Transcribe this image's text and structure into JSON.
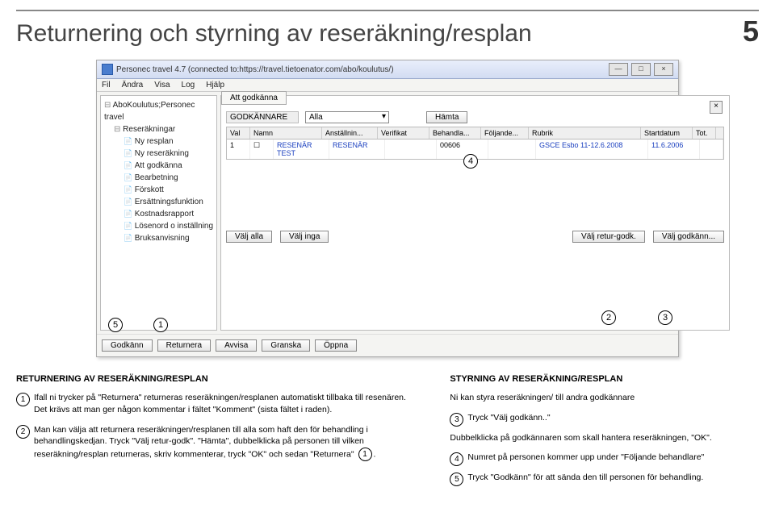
{
  "page": {
    "title": "Returnering och styrning av reseräkning/resplan",
    "number": "5"
  },
  "app": {
    "title": "Personec travel 4.7   (connected to:https://travel.tietoenator.com/abo/koulutus/)",
    "menu": [
      "Fil",
      "Ändra",
      "Visa",
      "Log",
      "Hjälp"
    ],
    "tree": {
      "root": "AboKoulutus;Personec travel",
      "group": "Reseräkningar",
      "items": [
        "Ny resplan",
        "Ny reseräkning",
        "Att godkänna",
        "Bearbetning",
        "Förskott",
        "Ersättningsfunktion",
        "Kostnadsrapport",
        "Lösenord o inställning",
        "Bruksanvisning"
      ]
    },
    "panel": {
      "tab": "Att godkänna",
      "filter_label": "GODKÄNNARE",
      "filter_value": "Alla",
      "fetch_btn": "Hämta",
      "columns": [
        "Val",
        "Namn",
        "Anställnin...",
        "Verifikat",
        "Behandla...",
        "Följande...",
        "Rubrik",
        "Startdatum",
        "Tot."
      ],
      "row": {
        "val": "1",
        "chk": "☐",
        "namn": "RESENÄR TEST",
        "anst": "RESENÄR",
        "ver": "",
        "beh": "00606",
        "folj": "",
        "rubrik": "GSCE Esbo 11-12.6.2008",
        "start": "11.6.2006",
        "tot": ""
      },
      "mid_buttons": {
        "valj_alla": "Välj alla",
        "valj_inga": "Välj inga",
        "valj_retur": "Välj retur-godk.",
        "valj_godk": "Välj godkänn..."
      },
      "bottom": [
        "Godkänn",
        "Returnera",
        "Avvisa",
        "Granska",
        "Öppna"
      ]
    }
  },
  "left": {
    "heading": "RETURNERING AV RESERÄKNING/RESPLAN",
    "p1": "Ifall ni trycker på \"Returnera\" returneras reseräkningen/resplanen automatiskt tillbaka till resenären. Det krävs att man ger någon kommentar i fältet \"Komment\" (sista fältet i raden).",
    "p2a": "Man kan välja att returnera reseräkningen/resplanen till alla som haft den för behandling i behandlingskedjan. Tryck \"Välj retur-godk\". \"Hämta\", dubbelklicka på personen till vilken reseräkning/resplan returneras, skriv kommenterar, tryck \"OK\" och sedan \"Returnera\"",
    "p2b_num": "1",
    "p2b_end": "."
  },
  "right": {
    "heading": "STYRNING AV RESERÄKNING/RESPLAN",
    "p1": "Ni kan styra reseräkningen/ till andra godkännare",
    "p3": "Tryck \"Välj godkänn..\"",
    "p_dbl": "Dubbelklicka på godkännaren som skall hantera reseräkningen, \"OK\".",
    "p4": "Numret på personen kommer upp under \"Följande behandlare\"",
    "p5": "Tryck \"Godkänn\" för att sända den till personen för behandling."
  }
}
